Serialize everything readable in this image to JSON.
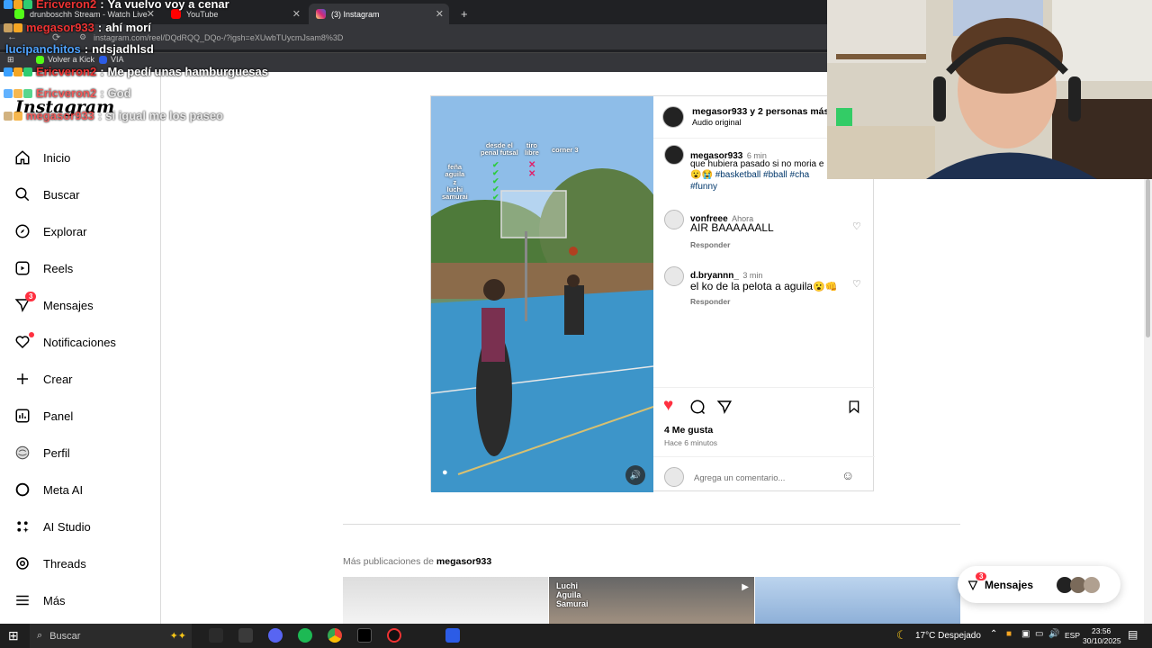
{
  "browser": {
    "tabs": [
      {
        "title": "drunboschh Stream - Watch Live",
        "favicon_color": "#53fc18"
      },
      {
        "title": "YouTube",
        "favicon_color": "#ff0000"
      },
      {
        "title": "(3) Instagram",
        "favicon_color": "#d62976"
      }
    ],
    "url": "instagram.com/reel/DQdRQQ_DQo-/?igsh=eXUwbTUycmJsam8%3D",
    "bookmarks": [
      {
        "label": "Volver a Kick",
        "color": "#53fc18"
      },
      {
        "label": "VIA",
        "color": "#2c5ce6"
      }
    ]
  },
  "chat": [
    {
      "user": "Ericveron2",
      "message": "Ya vuelvo voy a cenar",
      "user_color": "#e33",
      "faint": false
    },
    {
      "user": "megasor933",
      "message": "ahí morí",
      "user_color": "#e33",
      "faint": false
    },
    {
      "user": "lucipanchitos",
      "message": "ndsjadhlsd",
      "user_color": "#4fa3ff",
      "faint": false
    },
    {
      "user": "Ericveron2",
      "message": "Me pedí unas hamburguesas",
      "user_color": "#e33",
      "faint": false
    },
    {
      "user": "Ericveron2",
      "message": "God",
      "user_color": "#e33",
      "faint": true
    },
    {
      "user": "megasor933",
      "message": "si igual me los paseo",
      "user_color": "#e33",
      "faint": true
    }
  ],
  "instagram": {
    "logo": "Instagram",
    "nav": [
      {
        "label": "Inicio",
        "icon": "home-icon"
      },
      {
        "label": "Buscar",
        "icon": "search-icon"
      },
      {
        "label": "Explorar",
        "icon": "compass-icon"
      },
      {
        "label": "Reels",
        "icon": "reels-icon"
      },
      {
        "label": "Mensajes",
        "icon": "messenger-icon",
        "badge": "3"
      },
      {
        "label": "Notificaciones",
        "icon": "heart-icon"
      },
      {
        "label": "Crear",
        "icon": "plus-icon"
      },
      {
        "label": "Panel",
        "icon": "dashboard-icon"
      },
      {
        "label": "Perfil",
        "icon": "avatar-icon"
      },
      {
        "label": "Meta AI",
        "icon": "meta-ai-icon"
      },
      {
        "label": "AI Studio",
        "icon": "ai-studio-icon"
      },
      {
        "label": "Threads",
        "icon": "threads-icon"
      },
      {
        "label": "Más",
        "icon": "menu-icon"
      }
    ],
    "post": {
      "author": "megasor933 y 2 personas más",
      "audio": "Audio original",
      "overlay": {
        "left_names": "feña\naguila\nz\nluchi\nsamurai",
        "col1": "desde el\npenal futsal",
        "col2": "tiro\nlibre",
        "col3": "corner 3"
      },
      "caption": {
        "user": "megasor933",
        "time": "6 min",
        "text": "que hubiera pasado si no moria e",
        "tags": "#basketball #bball #cha",
        "tags2": "#funny"
      },
      "comments": [
        {
          "user": "vonfreee",
          "time": "Ahora",
          "text": "AIR BAAAAAALL",
          "reply": "Responder"
        },
        {
          "user": "d.bryannn_",
          "time": "3 min",
          "text": "el ko de la pelota a aguila",
          "reply": "Responder"
        }
      ],
      "likes": "4 Me gusta",
      "posted": "Hace 6 minutos",
      "comment_placeholder": "Agrega un comentario..."
    },
    "more_posts_prefix": "Más publicaciones de ",
    "more_posts_user": "megasor933",
    "thumb_overlay": "Luchi\nAguila\nSamurai",
    "messages_pill": {
      "label": "Mensajes",
      "badge": "3"
    }
  },
  "taskbar": {
    "search_placeholder": "Buscar",
    "weather": "17°C Despejado",
    "lang": "ESP",
    "time": "23:56",
    "date": "30/10/2025"
  }
}
